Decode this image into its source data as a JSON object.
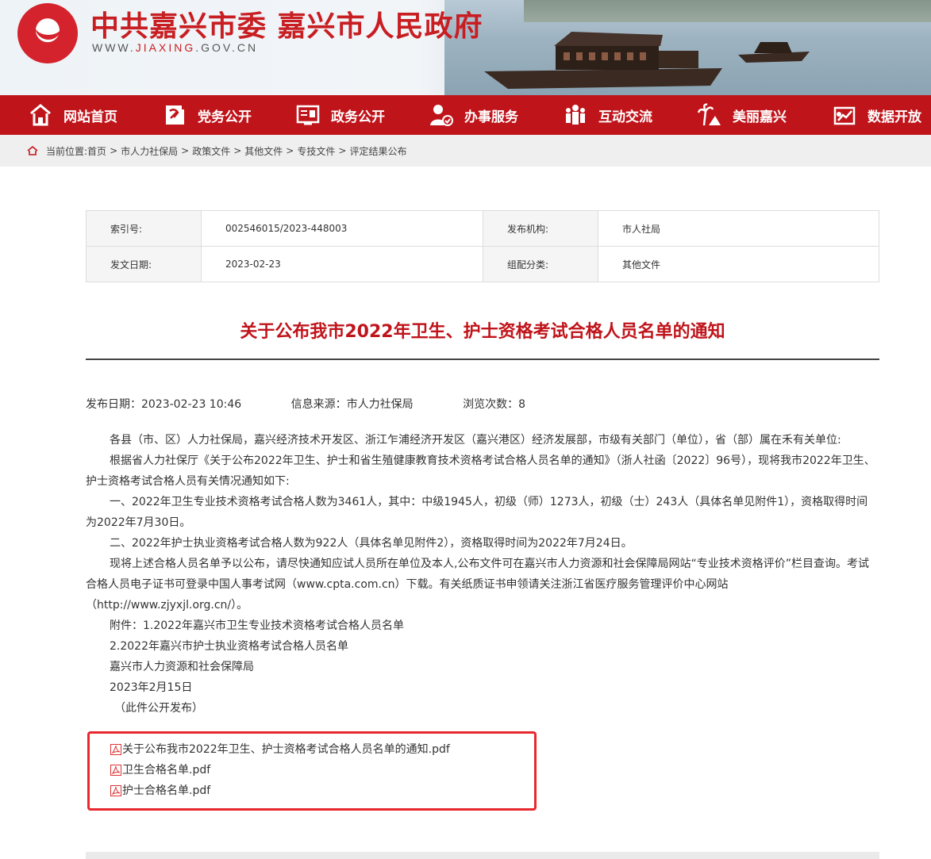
{
  "header": {
    "title": "中共嘉兴市委 嘉兴市人民政府",
    "url_prefix": "WWW.",
    "url_highlight": "JIAXING",
    "url_suffix": ".GOV.CN"
  },
  "nav": {
    "items": [
      {
        "label": "网站首页",
        "icon": "home-icon"
      },
      {
        "label": "党务公开",
        "icon": "party-icon"
      },
      {
        "label": "政务公开",
        "icon": "government-icon"
      },
      {
        "label": "办事服务",
        "icon": "service-icon"
      },
      {
        "label": "互动交流",
        "icon": "people-icon"
      },
      {
        "label": "美丽嘉兴",
        "icon": "scenery-icon"
      },
      {
        "label": "数据开放",
        "icon": "data-icon"
      }
    ]
  },
  "breadcrumb": {
    "prefix": "当前位置:",
    "items": [
      "首页",
      "市人力社保局",
      "政策文件",
      "其他文件",
      "专技文件",
      "评定结果公布"
    ]
  },
  "meta": {
    "index_label": "索引号:",
    "index_value": "002546015/2023-448003",
    "org_label": "发布机构:",
    "org_value": "市人社局",
    "date_label": "发文日期:",
    "date_value": "2023-02-23",
    "category_label": "组配分类:",
    "category_value": "其他文件"
  },
  "document": {
    "title": "关于公布我市2022年卫生、护士资格考试合格人员名单的通知",
    "publish_date": "发布日期：2023-02-23 10:46",
    "source": "信息来源：市人力社保局",
    "views": "浏览次数：8",
    "paragraphs": [
      "各县（市、区）人力社保局，嘉兴经济技术开发区、浙江乍浦经济开发区（嘉兴港区）经济发展部，市级有关部门（单位），省（部）属在禾有关单位:",
      "根据省人力社保厅《关于公布2022年卫生、护士和省生殖健康教育技术资格考试合格人员名单的通知》（浙人社函〔2022〕96号），现将我市2022年卫生、护士资格考试合格人员有关情况通知如下:",
      "一、2022年卫生专业技术资格考试合格人数为3461人，其中：中级1945人，初级（师）1273人，初级（士）243人（具体名单见附件1），资格取得时间为2022年7月30日。",
      "二、2022年护士执业资格考试合格人数为922人（具体名单见附件2），资格取得时间为2022年7月24日。",
      "现将上述合格人员名单予以公布，请尽快通知应试人员所在单位及本人,公布文件可在嘉兴市人力资源和社会保障局网站“专业技术资格评价”栏目查询。考试合格人员电子证书可登录中国人事考试网（www.cpta.com.cn）下载。有关纸质证书申领请关注浙江省医疗服务管理评价中心网站（http://www.zjyxjl.org.cn/）。",
      "附件：1.2022年嘉兴市卫生专业技术资格考试合格人员名单",
      "2.2022年嘉兴市护士执业资格考试合格人员名单",
      "嘉兴市人力资源和社会保障局",
      "2023年2月15日",
      "（此件公开发布）"
    ],
    "attachments": [
      "关于公布我市2022年卫生、护士资格考试合格人员名单的通知.pdf",
      "卫生合格名单.pdf",
      "护士合格名单.pdf"
    ]
  },
  "colors": {
    "brand_red": "#c0141b",
    "highlight_red": "#e8282e"
  }
}
